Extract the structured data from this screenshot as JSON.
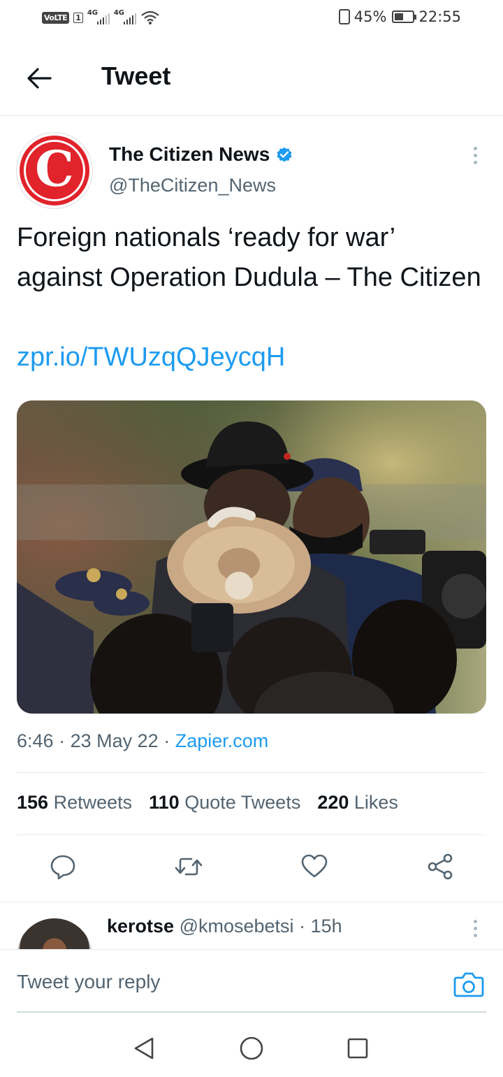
{
  "status_bar": {
    "volte": "VoLTE",
    "sim": "1",
    "net1": "4G",
    "net2": "4G",
    "battery": "45%",
    "time": "22:55"
  },
  "header": {
    "title": "Tweet"
  },
  "tweet": {
    "author_name": "The Citizen News",
    "author_handle": "@TheCitizen_News",
    "avatar_letter": "C",
    "text": "Foreign nationals ‘ready for war’ against Operation Dudula – The Citizen",
    "link": "zpr.io/TWUzqQJeycqH",
    "time": "6:46",
    "date": "23 May 22",
    "source": "Zapier.com",
    "stats": {
      "retweets_count": "156",
      "retweets_label": "Retweets",
      "quotes_count": "110",
      "quotes_label": "Quote Tweets",
      "likes_count": "220",
      "likes_label": "Likes"
    }
  },
  "reply_preview": {
    "name": "kerotse",
    "handle": "@kmosebetsi",
    "age": "15h"
  },
  "composer": {
    "placeholder": "Tweet your reply"
  },
  "colors": {
    "accent": "#1d9bf0",
    "brand_red": "#e1232b",
    "secondary_text": "#536471"
  }
}
